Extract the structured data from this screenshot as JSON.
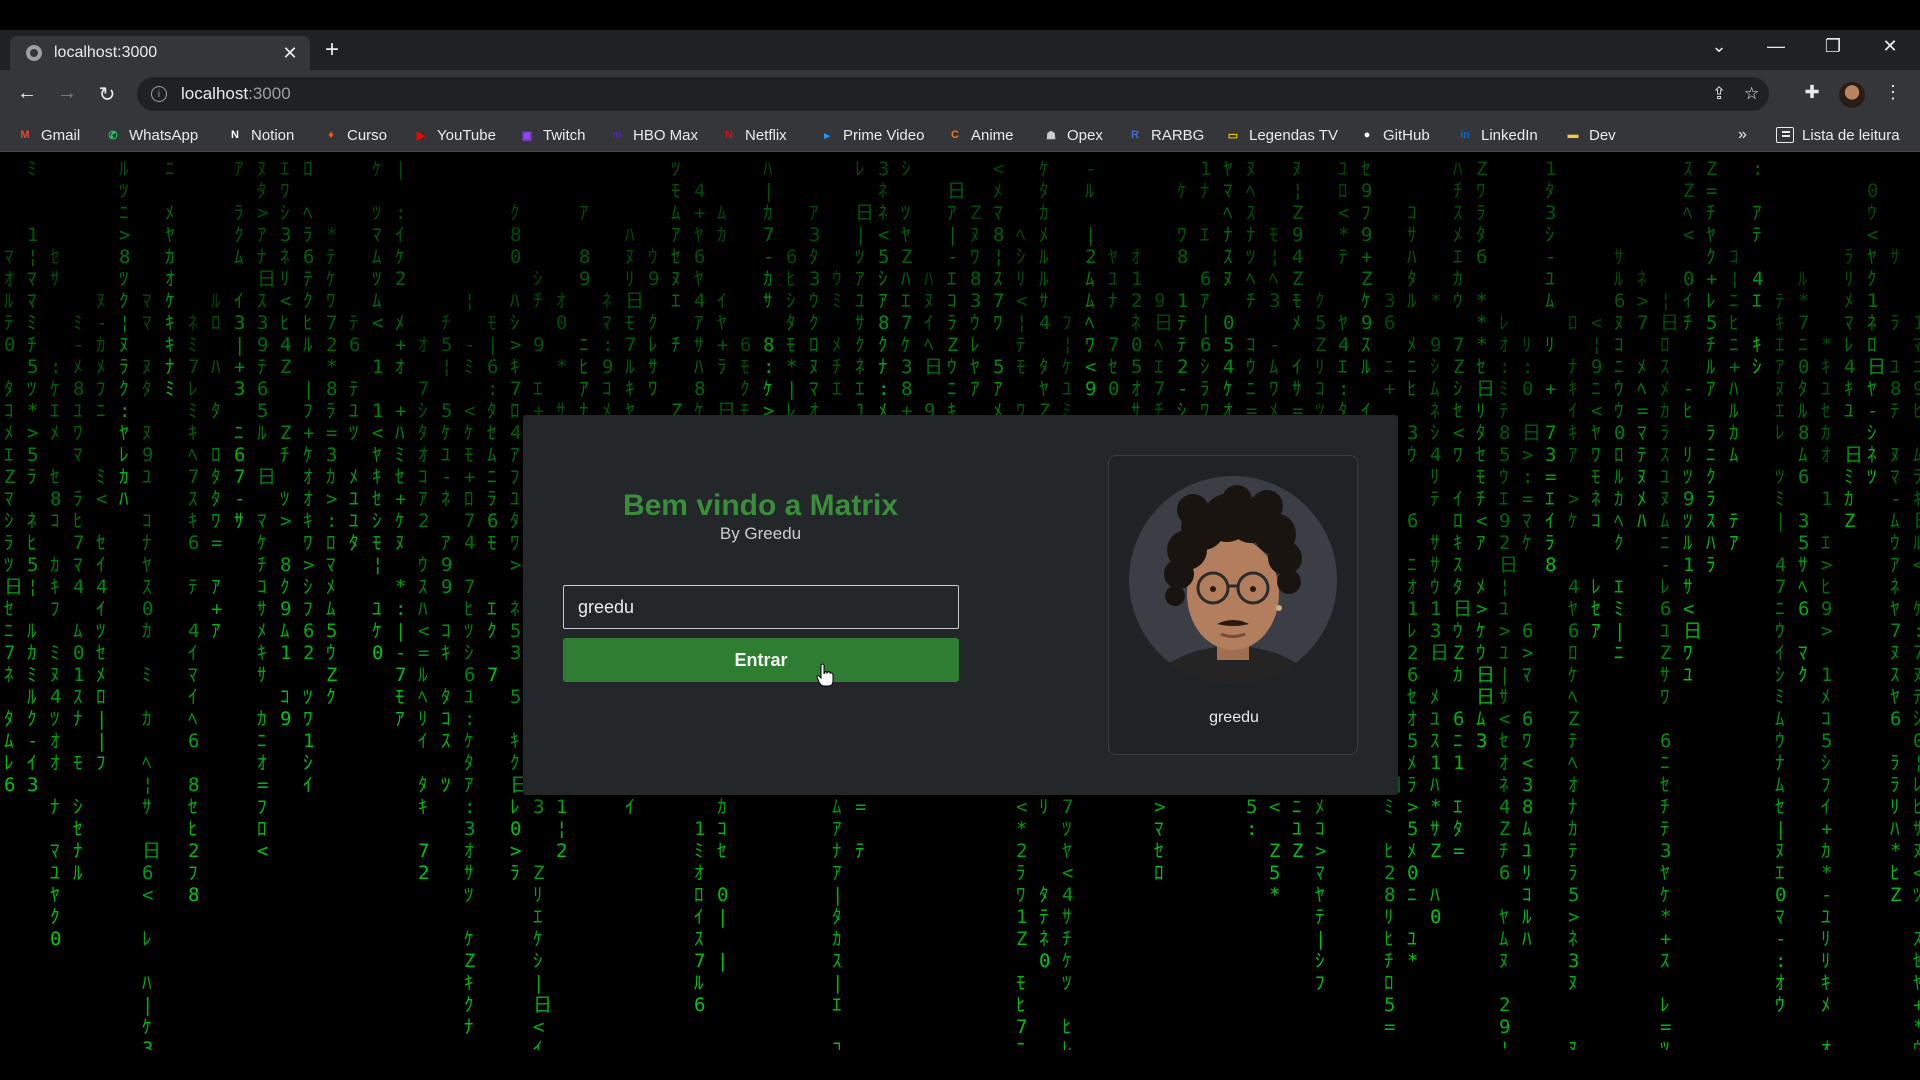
{
  "browser": {
    "tab": {
      "title": "localhost:3000"
    },
    "address": {
      "host": "localhost",
      "port": ":3000"
    }
  },
  "bookmarks": [
    {
      "label": "Gmail",
      "icon": "gmail-icon",
      "color": "#ea4335"
    },
    {
      "label": "WhatsApp",
      "icon": "whatsapp-icon",
      "color": "#25d366"
    },
    {
      "label": "Notion",
      "icon": "notion-icon",
      "color": "#ffffff"
    },
    {
      "label": "Curso",
      "icon": "flame-icon",
      "color": "#f4511e"
    },
    {
      "label": "YouTube",
      "icon": "youtube-icon",
      "color": "#ff0000"
    },
    {
      "label": "Twitch",
      "icon": "twitch-icon",
      "color": "#9146ff"
    },
    {
      "label": "HBO Max",
      "icon": "hbomax-icon",
      "color": "#5822b4"
    },
    {
      "label": "Netflix",
      "icon": "netflix-icon",
      "color": "#e50914"
    },
    {
      "label": "Prime Video",
      "icon": "primevideo-icon",
      "color": "#1a98ff"
    },
    {
      "label": "Anime",
      "icon": "crunchyroll-icon",
      "color": "#f47521"
    },
    {
      "label": "Opex",
      "icon": "opex-icon",
      "color": "#cccccc"
    },
    {
      "label": "RARBG",
      "icon": "rarbg-icon",
      "color": "#3b6fd6"
    },
    {
      "label": "Legendas TV",
      "icon": "legendas-icon",
      "color": "#f2c200"
    },
    {
      "label": "GitHub",
      "icon": "github-icon",
      "color": "#ffffff"
    },
    {
      "label": "LinkedIn",
      "icon": "linkedin-icon",
      "color": "#0a66c2"
    },
    {
      "label": "Dev",
      "icon": "folder-icon",
      "color": "#f6c744"
    }
  ],
  "reading_list": {
    "label": "Lista de leitura"
  },
  "login": {
    "title": "Bem vindo a Matrix",
    "subtitle": "By Greedu",
    "username_value": "greedu",
    "submit_label": "Entrar"
  },
  "profile": {
    "name": "greedu"
  },
  "theme": {
    "matrix_green": "#00c814",
    "button_green": "#2e7d32",
    "title_green": "#3a8d3a"
  }
}
